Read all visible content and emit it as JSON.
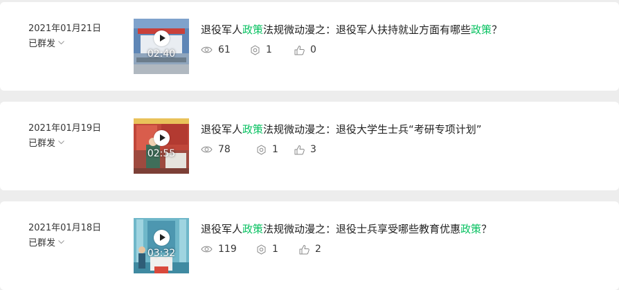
{
  "posts": [
    {
      "date": "2021年01月21日",
      "status": "已群发",
      "duration": "02:40",
      "title_prefix": "退役军人",
      "title_hl1": "政策",
      "title_mid": "法规微动漫之：退役军人扶持就业方面有哪些",
      "title_hl2": "政策",
      "title_suffix": "？",
      "views": "61",
      "shares": "1",
      "likes": "0"
    },
    {
      "date": "2021年01月19日",
      "status": "已群发",
      "duration": "02:55",
      "title_prefix": "退役军人",
      "title_hl1": "政策",
      "title_mid": "法规微动漫之：退役大学生士兵“考研专项计划”",
      "title_hl2": "",
      "title_suffix": "",
      "views": "78",
      "shares": "1",
      "likes": "3"
    },
    {
      "date": "2021年01月18日",
      "status": "已群发",
      "duration": "03:32",
      "title_prefix": "退役军人",
      "title_hl1": "政策",
      "title_mid": "法规微动漫之：退役士兵享受哪些教育优惠",
      "title_hl2": "政策",
      "title_suffix": "？",
      "views": "119",
      "shares": "1",
      "likes": "2"
    }
  ],
  "colors": {
    "highlight": "#07c160",
    "background": "#ededed",
    "card": "#ffffff"
  },
  "icons": {
    "views": "eye-icon",
    "shares": "share-icon",
    "likes": "thumbs-up-icon",
    "status": "chevron-down-icon",
    "play": "play-icon"
  }
}
